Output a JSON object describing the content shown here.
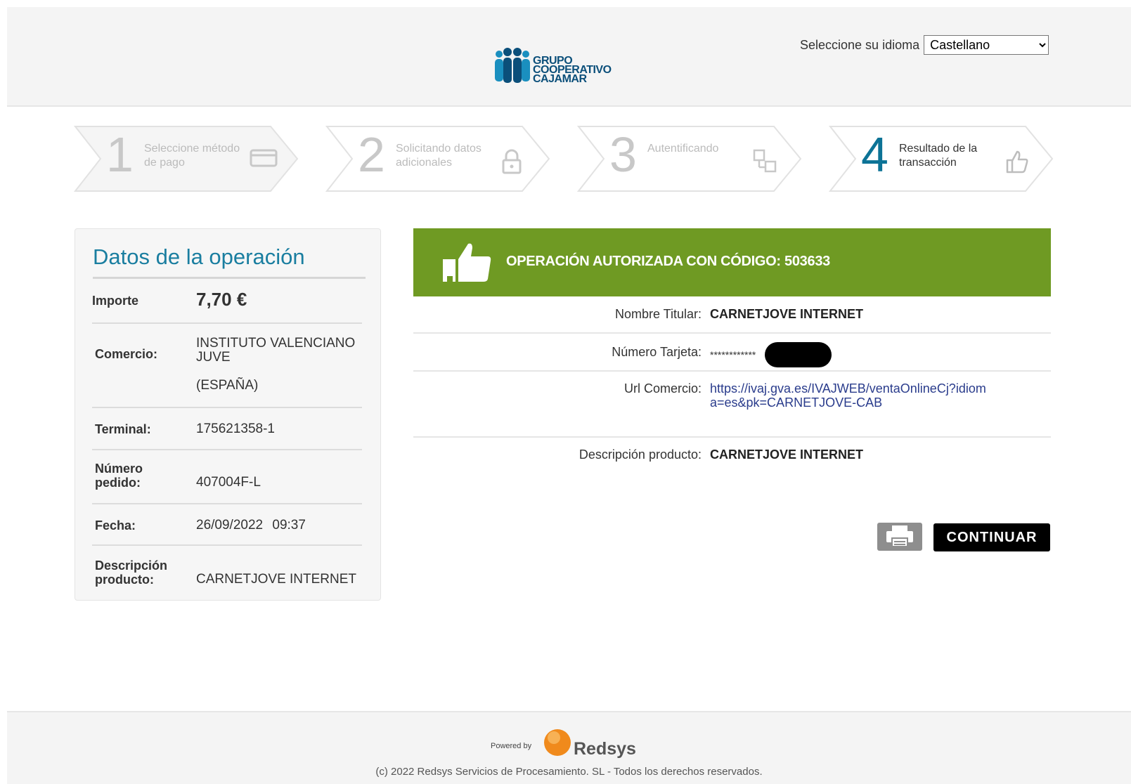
{
  "header": {
    "logo_text_line1": "GRUPO",
    "logo_text_line2": "COOPERATIVO",
    "logo_text_line3": "CAJAMAR",
    "language_label": "Seleccione su idioma",
    "language_selected": "Castellano"
  },
  "steps": [
    {
      "number": "1",
      "label": "Seleccione método de pago",
      "icon": "credit-card-icon",
      "active": false
    },
    {
      "number": "2",
      "label": "Solicitando datos adicionales",
      "icon": "lock-icon",
      "active": false
    },
    {
      "number": "3",
      "label": "Autentificando",
      "icon": "authenticate-icon",
      "active": false
    },
    {
      "number": "4",
      "label": "Resultado de la transacción",
      "icon": "thumbs-up-icon",
      "active": true
    }
  ],
  "operation": {
    "title": "Datos de la operación",
    "amount_label": "Importe",
    "amount_value": "7,70 €",
    "merchant_label": "Comercio:",
    "merchant_value": "INSTITUTO VALENCIANO JUVE",
    "merchant_country": "(ESPAÑA)",
    "terminal_label": "Terminal:",
    "terminal_value": "175621358-1",
    "order_label": "Número pedido:",
    "order_value": "407004F-L",
    "date_label": "Fecha:",
    "date_value": "26/09/2022",
    "time_value": "09:37",
    "description_label": "Descripción producto:",
    "description_value": "CARNETJOVE INTERNET"
  },
  "result": {
    "banner_text": "OPERACIÓN AUTORIZADA CON CÓDIGO: 503633",
    "holder_label": "Nombre Titular:",
    "holder_value": "CARNETJOVE INTERNET",
    "card_label": "Número Tarjeta:",
    "card_value_masked": "************",
    "url_label": "Url Comercio:",
    "url_value": "https://ivaj.gva.es/IVAJWEB/ventaOnlineCj?idioma=es&pk=CARNETJOVE-CAB",
    "description_label": "Descripción producto:",
    "description_value": "CARNETJOVE INTERNET"
  },
  "actions": {
    "continue_label": "CONTINUAR",
    "print_icon": "printer-icon"
  },
  "footer": {
    "powered_by": "Powered by",
    "brand": "Redsys",
    "copyright": "(c) 2022 Redsys Servicios de Procesamiento. SL - Todos los derechos reservados."
  },
  "colors": {
    "accent_blue": "#1a7ea0",
    "success_green": "#6f9a23",
    "logo_blue": "#0b4f7a",
    "redsys_orange": "#f08a1c"
  }
}
